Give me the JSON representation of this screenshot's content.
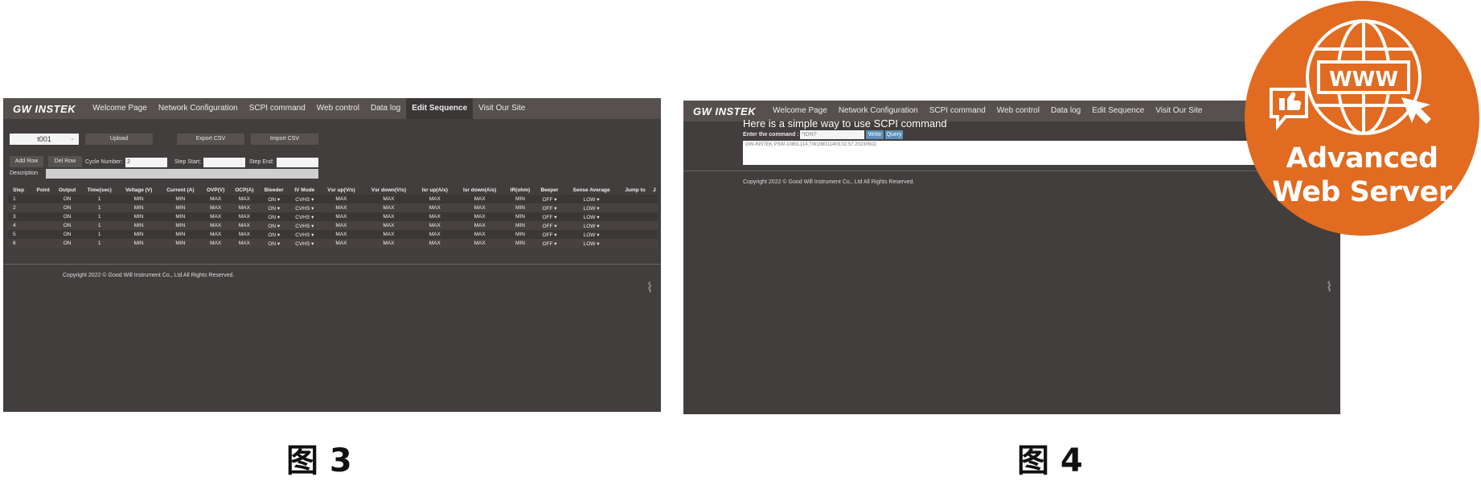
{
  "fig3": {
    "logo": "GW INSTEK",
    "nav": [
      "Welcome Page",
      "Network Configuration",
      "SCPI command",
      "Web control",
      "Data log",
      "Edit Sequence",
      "Visit Our Site"
    ],
    "active_nav": "Edit Sequence",
    "sequence_select": "t001",
    "upload_label": "Upload",
    "export_csv_label": "Export CSV",
    "import_csv_label": "Import CSV",
    "add_row_label": "Add Row",
    "del_row_label": "Del Row",
    "cycle_number_label": "Cycle Number:",
    "cycle_number_value": "2",
    "step_start_label": "Step Start:",
    "step_end_label": "Step End:",
    "description_label": "Description",
    "columns": [
      "Step",
      "Point",
      "Output",
      "Time(sec)",
      "Voltage (V)",
      "Current (A)",
      "OVP(V)",
      "OCP(A)",
      "Bleeder",
      "IV Mode",
      "Vsr up(V/s)",
      "Vsr down(V/s)",
      "Isr up(A/s)",
      "Isr down(A/s)",
      "IR(ohm)",
      "Beeper",
      "Sense Average",
      "Jump to",
      "J"
    ],
    "rows": [
      [
        "1",
        "",
        "ON",
        "1",
        "MIN",
        "MIN",
        "MAX",
        "MAX",
        "ON",
        "CVHS",
        "MAX",
        "MAX",
        "MAX",
        "MAX",
        "MIN",
        "OFF",
        "LOW",
        "",
        ""
      ],
      [
        "2",
        "",
        "ON",
        "1",
        "MIN",
        "MIN",
        "MAX",
        "MAX",
        "ON",
        "CVHS",
        "MAX",
        "MAX",
        "MAX",
        "MAX",
        "MIN",
        "OFF",
        "LOW",
        "",
        ""
      ],
      [
        "3",
        "",
        "ON",
        "1",
        "MIN",
        "MIN",
        "MAX",
        "MAX",
        "ON",
        "CVHS",
        "MAX",
        "MAX",
        "MAX",
        "MAX",
        "MIN",
        "OFF",
        "LOW",
        "",
        ""
      ],
      [
        "4",
        "",
        "ON",
        "1",
        "MIN",
        "MIN",
        "MAX",
        "MAX",
        "ON",
        "CVHS",
        "MAX",
        "MAX",
        "MAX",
        "MAX",
        "MIN",
        "OFF",
        "LOW",
        "",
        ""
      ],
      [
        "5",
        "",
        "ON",
        "1",
        "MIN",
        "MIN",
        "MAX",
        "MAX",
        "ON",
        "CVHS",
        "MAX",
        "MAX",
        "MAX",
        "MAX",
        "MIN",
        "OFF",
        "LOW",
        "",
        ""
      ],
      [
        "6",
        "",
        "ON",
        "1",
        "MIN",
        "MIN",
        "MAX",
        "MAX",
        "ON",
        "CVHS",
        "MAX",
        "MAX",
        "MAX",
        "MAX",
        "MIN",
        "OFF",
        "LOW",
        "",
        ""
      ]
    ],
    "dropdown_columns": [
      8,
      9,
      15,
      16
    ],
    "copyright": "Copyright 2022 © Good Will Instrument Co., Ltd All Rights Reserved.",
    "caption": "图 3"
  },
  "fig4": {
    "logo": "GW INSTEK",
    "nav": [
      "Welcome Page",
      "Network Configuration",
      "SCPI command",
      "Web control",
      "Data log",
      "Edit Sequence",
      "Visit Our Site"
    ],
    "title": "Here is a simple way to use SCPI command",
    "enter_label": "Enter the command :",
    "command_value": "*IDN?",
    "write_label": "Write",
    "query_label": "Query",
    "response": "GW-INSTEK,PSW-1080L114,TW108011403,02.57.20230502",
    "copyright": "Copyright 2022 © Good Will Instrument Co., Ltd All Rights Reserved.",
    "caption": "图 4"
  },
  "badge": {
    "www": "WWW",
    "line1": "Advanced",
    "line2": "Web Server",
    "color": "#e06b21"
  }
}
